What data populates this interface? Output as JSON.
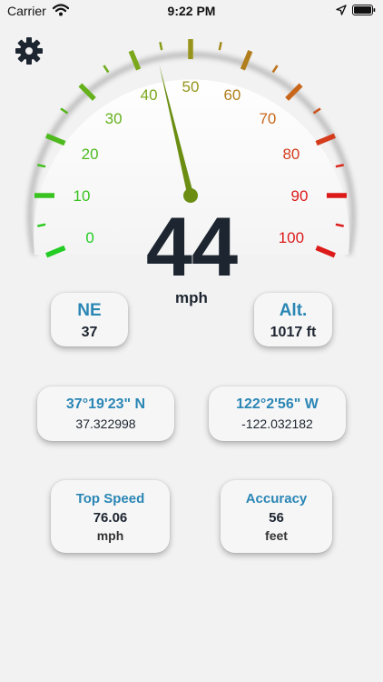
{
  "status_bar": {
    "carrier": "Carrier",
    "time": "9:22 PM"
  },
  "settings_icon": "gear-icon",
  "gauge": {
    "speed": 44,
    "unit": "mph",
    "min": 0,
    "max": 100,
    "tick_labels": [
      "0",
      "10",
      "20",
      "30",
      "40",
      "50",
      "60",
      "70",
      "80",
      "90",
      "100"
    ],
    "needle_value": 44,
    "colors": {
      "green": "#22cc22",
      "yellow_green": "#7aa81a",
      "olive": "#a48a1c",
      "orange": "#c8671c",
      "red": "#dd1a1a",
      "needle": "#6b8e12",
      "speed_text": "#1d2530",
      "accent_blue": "#2a86b5"
    }
  },
  "cards": {
    "heading": {
      "title": "NE",
      "value": "37"
    },
    "altitude": {
      "title": "Alt.",
      "value": "1017 ft"
    },
    "latitude": {
      "title": "37°19'23\" N",
      "value": "37.322998"
    },
    "longitude": {
      "title": "122°2'56\" W",
      "value": "-122.032182"
    },
    "top_speed": {
      "title": "Top Speed",
      "value": "76.06",
      "unit": "mph"
    },
    "accuracy": {
      "title": "Accuracy",
      "value": "56",
      "unit": "feet"
    }
  }
}
